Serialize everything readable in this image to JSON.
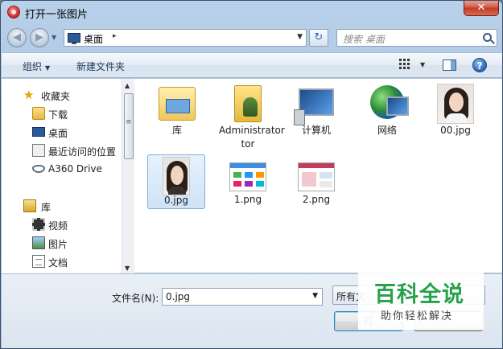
{
  "window": {
    "title": "打开一张图片",
    "close_label": "✕"
  },
  "address": {
    "location": "桌面",
    "separator": "▸"
  },
  "search": {
    "placeholder": "搜索 桌面"
  },
  "toolbar": {
    "organize": "组织",
    "new_folder": "新建文件夹",
    "help": "?"
  },
  "sidebar": {
    "items": [
      {
        "label": "收藏夹",
        "icon": "star-icon"
      },
      {
        "label": "下载",
        "icon": "download-folder-icon"
      },
      {
        "label": "桌面",
        "icon": "desktop-icon"
      },
      {
        "label": "最近访问的位置",
        "icon": "recent-places-icon"
      },
      {
        "label": "A360 Drive",
        "icon": "cloud-drive-icon"
      },
      {
        "label": "库",
        "icon": "libraries-icon"
      },
      {
        "label": "视频",
        "icon": "video-icon"
      },
      {
        "label": "图片",
        "icon": "pictures-icon"
      },
      {
        "label": "文档",
        "icon": "document-icon"
      }
    ]
  },
  "files": [
    {
      "name": "库",
      "icon": "library-folder-icon"
    },
    {
      "name": "Administrator",
      "name2": "tor",
      "icon": "user-folder-icon"
    },
    {
      "name": "计算机",
      "icon": "computer-icon"
    },
    {
      "name": "网络",
      "icon": "network-icon"
    },
    {
      "name": "00.jpg",
      "icon": "image-thumbnail"
    },
    {
      "name": "0.jpg",
      "icon": "image-thumbnail",
      "selected": true
    },
    {
      "name": "1.png",
      "icon": "image-thumbnail"
    },
    {
      "name": "2.png",
      "icon": "image-thumbnail"
    }
  ],
  "footer": {
    "filename_label": "文件名(N):",
    "filename_value": "0.jpg",
    "filetype_label": "所有文",
    "open_label": "打",
    "cancel_label": ""
  },
  "watermark": {
    "main": "百科全说",
    "sub": "助你轻松解决"
  }
}
